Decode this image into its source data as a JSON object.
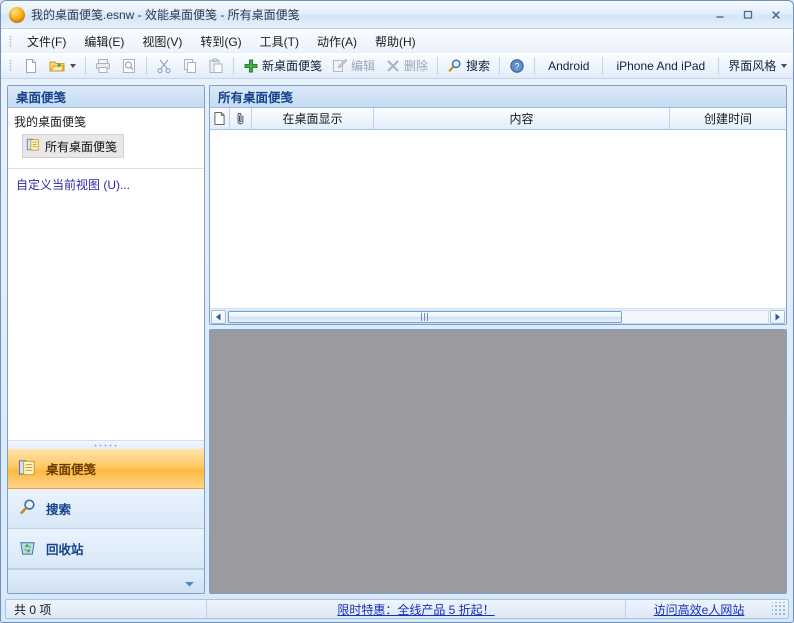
{
  "titlebar": {
    "title": "我的桌面便笺.esnw - 效能桌面便笺 - 所有桌面便笺",
    "minimize_label": "最小化",
    "maximize_label": "最大化",
    "close_label": "关闭"
  },
  "menubar": {
    "items": [
      {
        "label": "文件(F)"
      },
      {
        "label": "编辑(E)"
      },
      {
        "label": "视图(V)"
      },
      {
        "label": "转到(G)"
      },
      {
        "label": "工具(T)"
      },
      {
        "label": "动作(A)"
      },
      {
        "label": "帮助(H)"
      }
    ]
  },
  "toolbar": {
    "new_file": "",
    "open_file": "",
    "print": "",
    "print_preview": "",
    "cut": "",
    "copy": "",
    "paste": "",
    "new_note": "新桌面便笺",
    "edit": "编辑",
    "delete": "删除",
    "search": "搜索",
    "help": "",
    "android": "Android",
    "iphone_ipad": "iPhone And iPad",
    "skin": "界面风格"
  },
  "left_pane": {
    "header": "桌面便笺",
    "tree_root": "我的桌面便笺",
    "tree_node": "所有桌面便笺",
    "custom_view": "自定义当前视图 (U)...",
    "nav_items": [
      {
        "label": "桌面便笺",
        "icon": "note-icon",
        "active": true
      },
      {
        "label": "搜索",
        "icon": "magnifier-icon",
        "active": false
      },
      {
        "label": "回收站",
        "icon": "recycle-bin-icon",
        "active": false
      }
    ]
  },
  "list_pane": {
    "header": "所有桌面便笺",
    "columns": [
      {
        "label": "",
        "icon": "document-icon"
      },
      {
        "label": "",
        "icon": "paperclip-icon"
      },
      {
        "label": "在桌面显示"
      },
      {
        "label": "内容"
      },
      {
        "label": "创建时间"
      }
    ],
    "rows": [],
    "scroll": {
      "thumb_percent": 73
    }
  },
  "statusbar": {
    "count": "共 0 项",
    "promo": "限时特惠：全线产品 5 折起！",
    "site_link": "访问高效e人网站"
  },
  "colors": {
    "accent": "#15428b",
    "active_nav": "#ffb941",
    "preview_bg": "#9b9b9f",
    "border": "#7ba2ce"
  }
}
